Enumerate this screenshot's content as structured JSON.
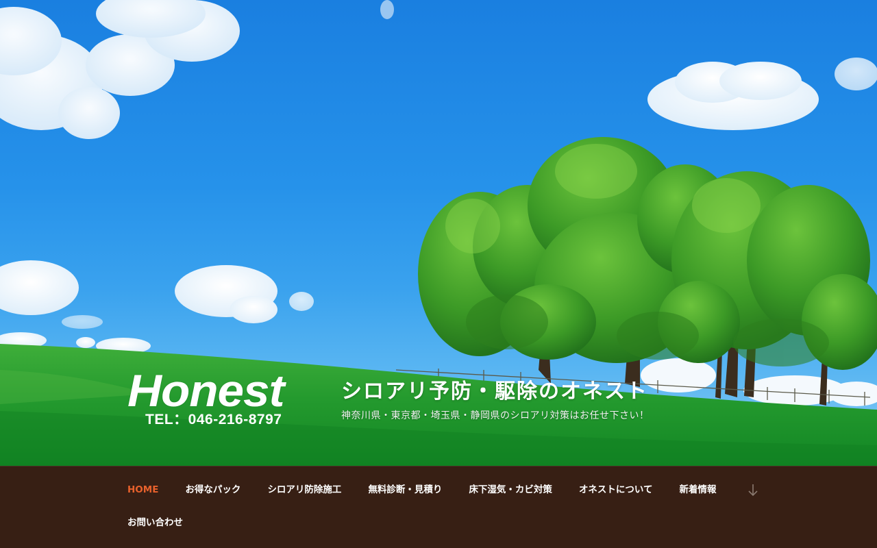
{
  "branding": {
    "logo_text": "Honest",
    "logo_tel": "TEL：046-216-8797",
    "site_title": "シロアリ予防・駆除のオネスト",
    "site_description": "神奈川県・東京都・埼玉県・静岡県のシロアリ対策はお任せ下さい！"
  },
  "nav": {
    "items": [
      {
        "label": "HOME",
        "active": true
      },
      {
        "label": "お得なパック"
      },
      {
        "label": "シロアリ防除施工"
      },
      {
        "label": "無料診断・見積り"
      },
      {
        "label": "床下湿気・カビ対策"
      },
      {
        "label": "オネストについて"
      },
      {
        "label": "新着情報"
      },
      {
        "label": "お問い合わせ"
      }
    ],
    "scroll_icon": "arrow-down-icon"
  },
  "colors": {
    "nav_background": "#371f14",
    "nav_active": "#e8612c",
    "nav_text": "#ffffff"
  }
}
